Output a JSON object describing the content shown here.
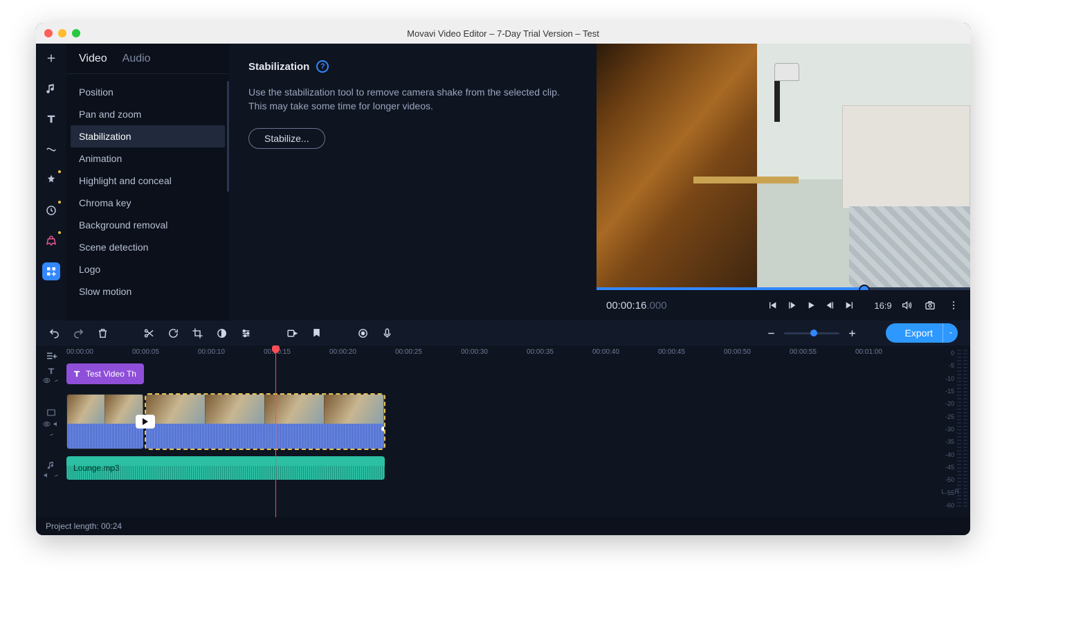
{
  "window": {
    "title": "Movavi Video Editor – 7-Day Trial Version – Test"
  },
  "tabs": {
    "video": "Video",
    "audio": "Audio"
  },
  "subnav": {
    "position": "Position",
    "pan_zoom": "Pan and zoom",
    "stabilization": "Stabilization",
    "animation": "Animation",
    "highlight": "Highlight and conceal",
    "chroma": "Chroma key",
    "bg_removal": "Background removal",
    "scene": "Scene detection",
    "logo": "Logo",
    "slowmo": "Slow motion"
  },
  "panel": {
    "heading": "Stabilization",
    "desc": "Use the stabilization tool to remove camera shake from the selected clip. This may take some time for longer videos.",
    "button": "Stabilize..."
  },
  "preview": {
    "time_main": "00:00:16",
    "time_ms": ".000",
    "aspect": "16:9"
  },
  "toolbar": {
    "export": "Export"
  },
  "ruler": [
    "00:00:00",
    "00:00:05",
    "00:00:10",
    "00:00:15",
    "00:00:20",
    "00:00:25",
    "00:00:30",
    "00:00:35",
    "00:00:40",
    "00:00:45",
    "00:00:50",
    "00:00:55",
    "00:01:00"
  ],
  "timeline": {
    "title_clip": "Test Video Th",
    "audio_clip": "Lounge.mp3"
  },
  "meter_labels": [
    "0",
    "-5",
    "-10",
    "-15",
    "-20",
    "-25",
    "-30",
    "-35",
    "-40",
    "-45",
    "-50",
    "-55",
    "-60"
  ],
  "meter_lr": "L   R",
  "status": {
    "project_length": "Project length: 00:24"
  }
}
